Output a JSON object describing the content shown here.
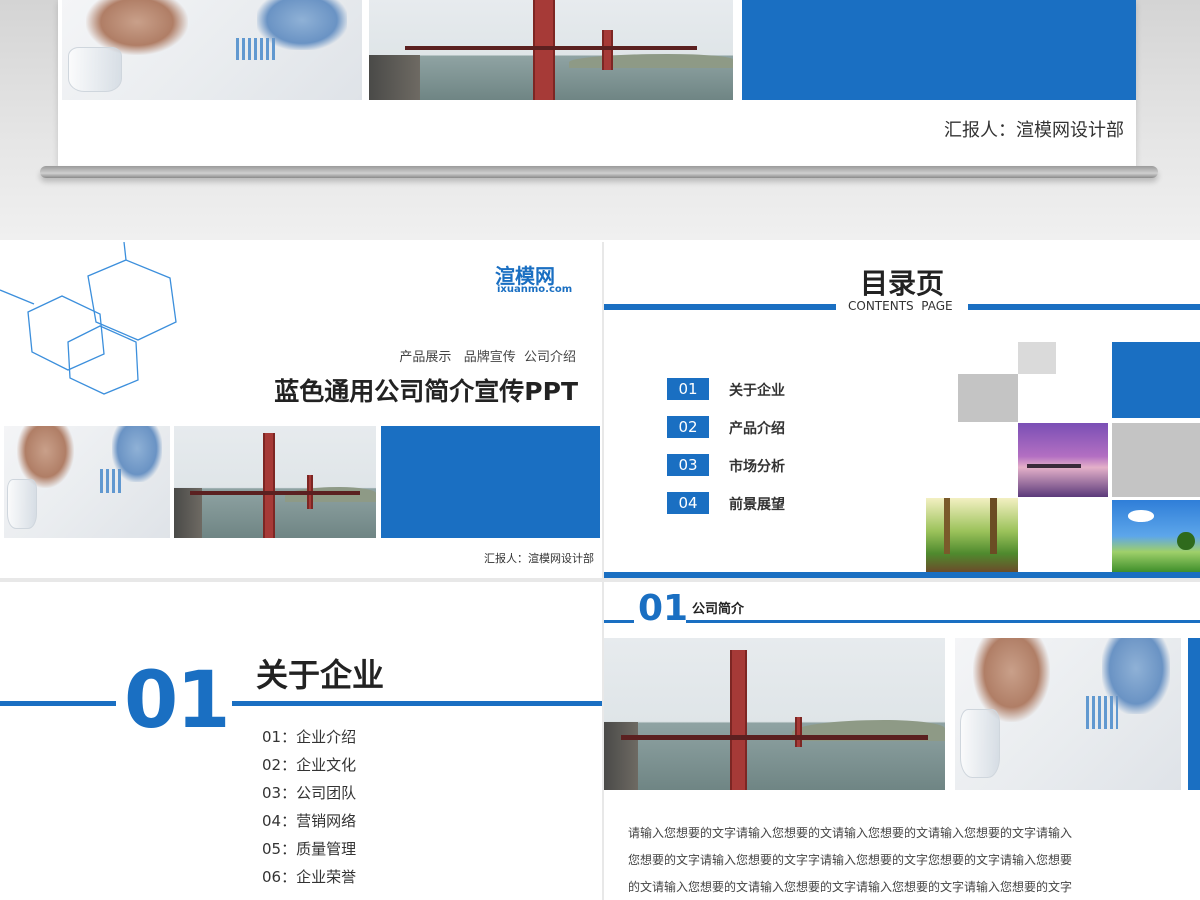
{
  "top_slide": {
    "reporter": "汇报人：渲模网设计部"
  },
  "cover_slide": {
    "logo_name": "渲模网",
    "logo_url": "ixuanmo.com",
    "tags": "产品展示   品牌宣传  公司介绍",
    "title": "蓝色通用公司简介宣传PPT",
    "reporter": "汇报人：渲模网设计部"
  },
  "toc_slide": {
    "title": "目录页",
    "subtitle": "CONTENTS  PAGE",
    "items": [
      {
        "num": "01",
        "label": "关于企业"
      },
      {
        "num": "02",
        "label": "产品介绍"
      },
      {
        "num": "03",
        "label": "市场分析"
      },
      {
        "num": "04",
        "label": "前景展望"
      }
    ]
  },
  "section_slide": {
    "number": "01",
    "title": "关于企业",
    "items": [
      "01：企业介绍",
      "02：企业文化",
      "03：公司团队",
      "04：营销网络",
      "05：质量管理",
      "06：企业荣誉"
    ]
  },
  "intro_slide": {
    "number": "01",
    "title": "公司简介",
    "body_lines": [
      "请输入您想要的文字请输入您想要的文请输入您想要的文请输入您想要的文字请输入",
      "您想要的文字请输入您想要的文字字请输入您想要的文字您想要的文字请输入您想要",
      "的文请输入您想要的文请输入您想要的文字请输入您想要的文字请输入您想要的文字"
    ]
  },
  "colors": {
    "accent_blue": "#1a6fc2",
    "gray_block": "#c4c4c4",
    "background_gray": "#d9d9d9"
  }
}
